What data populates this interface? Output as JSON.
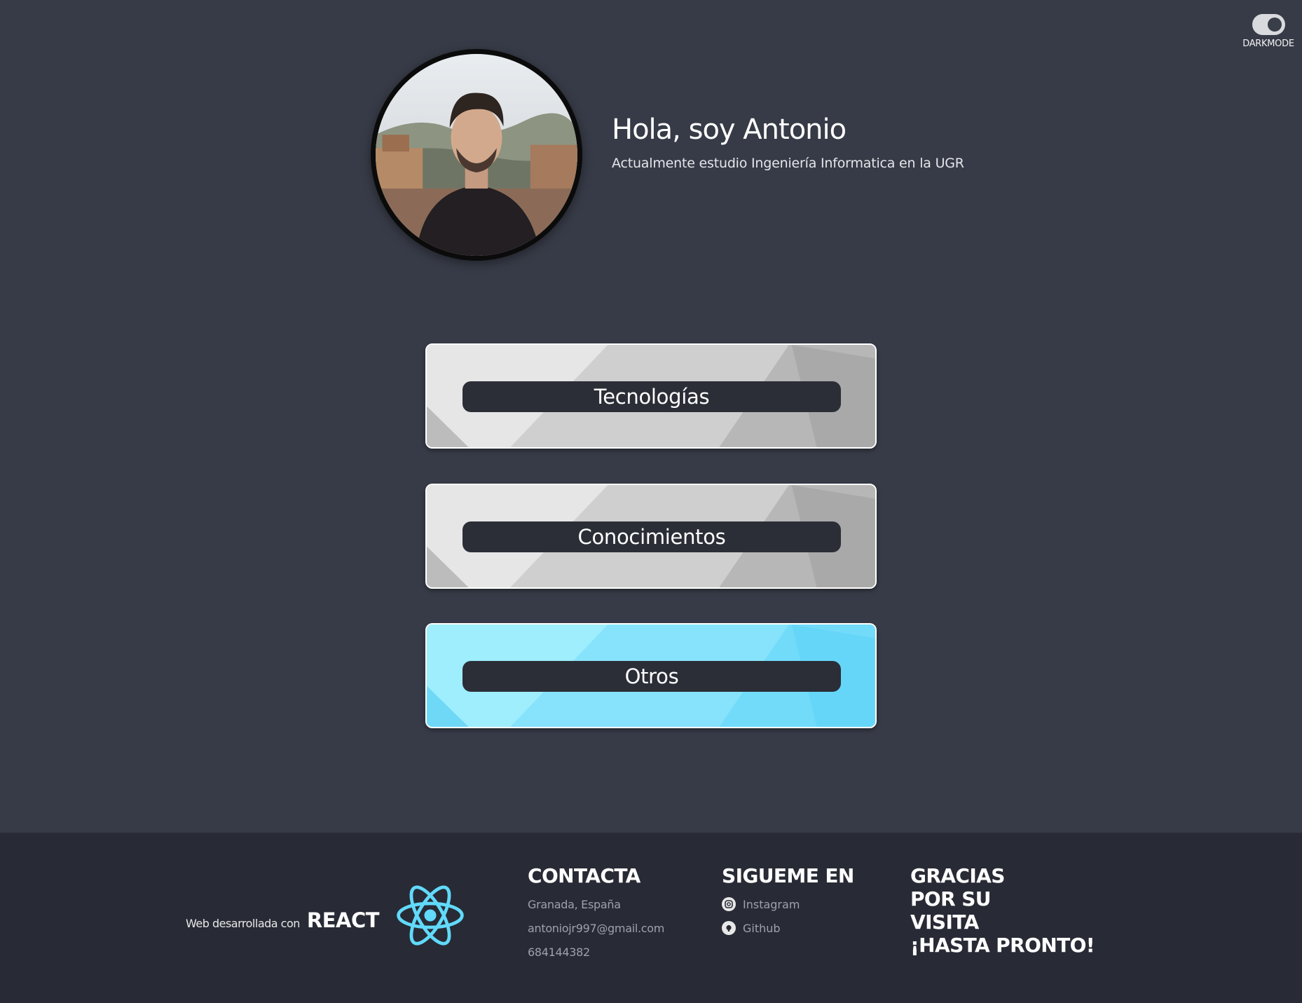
{
  "darkmode": {
    "label": "DARKMODE",
    "enabled": true
  },
  "hero": {
    "title": "Hola, soy Antonio",
    "subtitle": "Actualmente estudio Ingeniería Informatica en la UGR"
  },
  "cards": [
    {
      "label": "Tecnologías",
      "theme": "grey"
    },
    {
      "label": "Conocimientos",
      "theme": "grey"
    },
    {
      "label": "Otros",
      "theme": "cyan"
    }
  ],
  "footer": {
    "built_prefix": "Web desarrollada con",
    "built_framework": "REACT",
    "react_icon": "react-atom-icon",
    "react_color": "#61dafb",
    "contact": {
      "heading": "CONTACTA",
      "location": "Granada, España",
      "email": "antoniojr997@gmail.com",
      "phone": "684144382"
    },
    "follow": {
      "heading": "SIGUEME EN",
      "links": [
        {
          "label": "Instagram",
          "icon": "instagram-icon"
        },
        {
          "label": "Github",
          "icon": "github-icon"
        }
      ]
    },
    "thanks": [
      "GRACIAS",
      "POR SU",
      "VISITA",
      "¡HASTA PRONTO!"
    ]
  },
  "colors": {
    "background": "#373b47",
    "footer_background": "#282b35",
    "pill": "#2b2e37",
    "accent_cyan": "#7ae2fb"
  }
}
